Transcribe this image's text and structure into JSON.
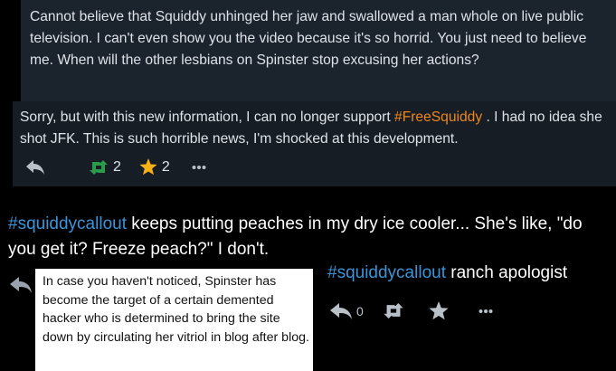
{
  "quote1": {
    "text": "Cannot believe that Squiddy unhinged her jaw and swallowed a man whole on live public television. I can't even show you the video because it's so horrid. You just need to believe me. When will the other lesbians on Spinster stop excusing her actions?"
  },
  "post2": {
    "text_before": "Sorry, but with this new information, I can no longer support ",
    "hashtag": "#FreeSquiddy",
    "text_after": " . I had no idea she shot JFK. This is such horrible news, I'm shocked at this development.",
    "actions": {
      "reply_icon": "reply-icon",
      "boost_icon": "boost-icon",
      "boost_count": "2",
      "favourite_icon": "star-icon",
      "favourite_count": "2",
      "more_icon": "more-icon"
    },
    "colors": {
      "boost": "#2b9a4a",
      "star": "#f5b01a"
    }
  },
  "main_post": {
    "hashtag": "#squiddycallout",
    "text": " keeps putting peaches in my dry ice cooler... She's like, \"do you get it? Freeze peach?\" I don't."
  },
  "note": {
    "text": "In case you haven't noticed, Spinster has become the target of a certain demented hacker who is determined to bring the site down by circulating her vitriol in blog after blog."
  },
  "ranch_post": {
    "hashtag": "#squiddycallout",
    "text": " ranch apologist",
    "actions": {
      "reply_icon": "reply-icon",
      "reply_count": "0",
      "boost_icon": "boost-icon",
      "favourite_icon": "star-icon",
      "more_icon": "more-icon"
    }
  },
  "colors": {
    "background": "#000000",
    "quote_bg": "#1b232d",
    "post_bg": "#161d25",
    "hashtag_blue": "#3b94d9",
    "hashtag_orange": "#f0871c"
  }
}
